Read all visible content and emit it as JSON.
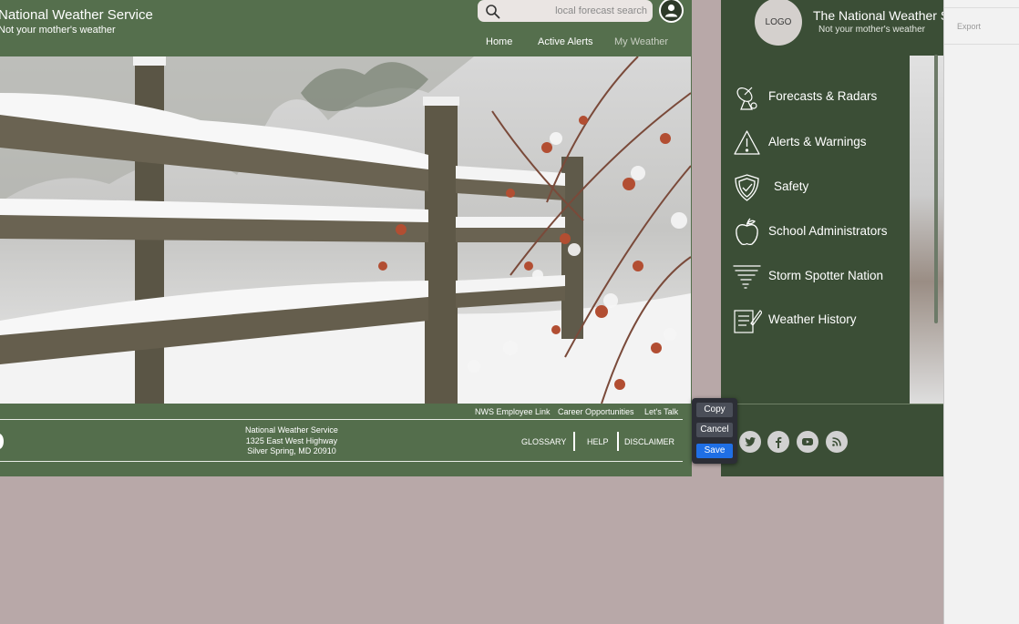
{
  "frame_main": {
    "header": {
      "title": "National Weather Service",
      "subtitle": "Not your mother's weather",
      "search_placeholder": "local forecast search",
      "user_icon": "user-icon"
    },
    "nav": [
      "Home",
      "Active Alerts",
      "My Weather"
    ],
    "footer": {
      "top_links": [
        "NWS Employee Link",
        "Career Opportunities",
        "Let's Talk"
      ],
      "address": [
        "National Weather Service",
        "1325 East West Highway",
        "Silver Spring, MD 20910"
      ],
      "links": [
        "GLOSSARY",
        "HELP",
        "DISCLAIMER"
      ]
    }
  },
  "frame_menu": {
    "logo": "LOGO",
    "title": "The National Weather Service",
    "subtitle": "Not your mother's weather",
    "menu": [
      {
        "label": "Forecasts & Radars",
        "icon": "satellite-dish-icon"
      },
      {
        "label": "Alerts & Warnings",
        "icon": "warning-triangle-icon"
      },
      {
        "label": "Safety",
        "icon": "shield-icon"
      },
      {
        "label": "School Administrators",
        "icon": "apple-icon"
      },
      {
        "label": "Storm Spotter Nation",
        "icon": "tornado-icon"
      },
      {
        "label": "Weather History",
        "icon": "notepad-pencil-icon"
      }
    ],
    "social": [
      "twitter-icon",
      "facebook-icon",
      "youtube-icon",
      "rss-icon"
    ]
  },
  "toolbar": {
    "copy": "Copy",
    "cancel": "Cancel",
    "save": "Save"
  },
  "side_panel": {
    "export": "Export"
  },
  "colors": {
    "canvas_bg": "#b8a8a8",
    "header_green": "#556f4d",
    "menu_green": "#3b4e36",
    "save_blue": "#1f6fe5"
  }
}
